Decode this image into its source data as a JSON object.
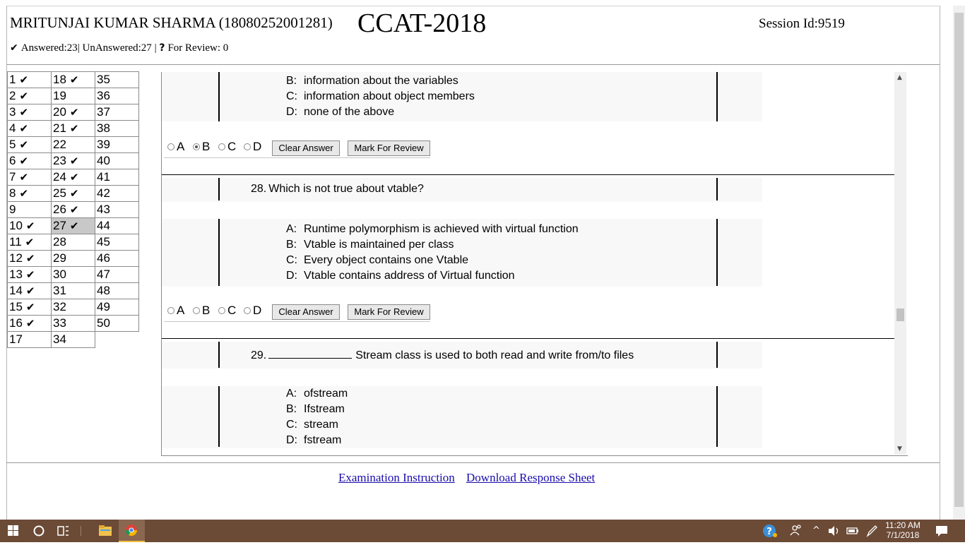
{
  "header": {
    "candidate": "MRITUNJAI KUMAR SHARMA (18080252001281)",
    "exam": "CCAT-2018",
    "session": "Session Id:9519"
  },
  "status": {
    "answered": "Answered:23",
    "sep1": "|",
    "unanswered": "UnAnswered:27",
    "sep2": "|",
    "review_icon": "?",
    "review": "For Review: 0"
  },
  "question_grid": {
    "current": 27,
    "columns": [
      [
        {
          "n": "1",
          "a": true
        },
        {
          "n": "2",
          "a": true
        },
        {
          "n": "3",
          "a": true
        },
        {
          "n": "4",
          "a": true
        },
        {
          "n": "5",
          "a": true
        },
        {
          "n": "6",
          "a": true
        },
        {
          "n": "7",
          "a": true
        },
        {
          "n": "8",
          "a": true
        },
        {
          "n": "9",
          "a": false
        },
        {
          "n": "10",
          "a": true
        },
        {
          "n": "11",
          "a": true
        },
        {
          "n": "12",
          "a": true
        },
        {
          "n": "13",
          "a": true
        },
        {
          "n": "14",
          "a": true
        },
        {
          "n": "15",
          "a": true
        },
        {
          "n": "16",
          "a": true
        },
        {
          "n": "17",
          "a": false
        }
      ],
      [
        {
          "n": "18",
          "a": true
        },
        {
          "n": "19",
          "a": false
        },
        {
          "n": "20",
          "a": true
        },
        {
          "n": "21",
          "a": true
        },
        {
          "n": "22",
          "a": false
        },
        {
          "n": "23",
          "a": true
        },
        {
          "n": "24",
          "a": true
        },
        {
          "n": "25",
          "a": true
        },
        {
          "n": "26",
          "a": true
        },
        {
          "n": "27",
          "a": true
        },
        {
          "n": "28",
          "a": false
        },
        {
          "n": "29",
          "a": false
        },
        {
          "n": "30",
          "a": false
        },
        {
          "n": "31",
          "a": false
        },
        {
          "n": "32",
          "a": false
        },
        {
          "n": "33",
          "a": false
        },
        {
          "n": "34",
          "a": false
        }
      ],
      [
        {
          "n": "35",
          "a": false
        },
        {
          "n": "36",
          "a": false
        },
        {
          "n": "37",
          "a": false
        },
        {
          "n": "38",
          "a": false
        },
        {
          "n": "39",
          "a": false
        },
        {
          "n": "40",
          "a": false
        },
        {
          "n": "41",
          "a": false
        },
        {
          "n": "42",
          "a": false
        },
        {
          "n": "43",
          "a": false
        },
        {
          "n": "44",
          "a": false
        },
        {
          "n": "45",
          "a": false
        },
        {
          "n": "46",
          "a": false
        },
        {
          "n": "47",
          "a": false
        },
        {
          "n": "48",
          "a": false
        },
        {
          "n": "49",
          "a": false
        },
        {
          "n": "50",
          "a": false
        }
      ]
    ]
  },
  "q27": {
    "options": [
      {
        "letter": "B:",
        "text": "information about the variables"
      },
      {
        "letter": "C:",
        "text": "information about object members"
      },
      {
        "letter": "D:",
        "text": "none of the above"
      }
    ],
    "selected": "B"
  },
  "q28": {
    "number": "28.",
    "text": "Which is not true about vtable?",
    "options": [
      {
        "letter": "A:",
        "text": "Runtime polymorphism is achieved with virtual function"
      },
      {
        "letter": "B:",
        "text": "Vtable is maintained per class"
      },
      {
        "letter": "C:",
        "text": "Every object contains one Vtable"
      },
      {
        "letter": "D:",
        "text": "Vtable contains address of Virtual function"
      }
    ],
    "selected": ""
  },
  "q29": {
    "number": "29.",
    "text": "Stream class is used to both read and write from/to files",
    "options": [
      {
        "letter": "A:",
        "text": "ofstream"
      },
      {
        "letter": "B:",
        "text": "Ifstream"
      },
      {
        "letter": "C:",
        "text": "stream"
      },
      {
        "letter": "D:",
        "text": "fstream"
      }
    ]
  },
  "answer_bar": {
    "labels": [
      "A",
      "B",
      "C",
      "D"
    ],
    "clear": "Clear Answer",
    "review": "Mark For Review"
  },
  "links": {
    "instruction": "Examination Instruction",
    "download": "Download Response Sheet"
  },
  "taskbar": {
    "time": "11:20 AM",
    "date": "7/1/2018",
    "notification_icon": "speech-bubble",
    "help_icon": "question-mark"
  },
  "colors": {
    "taskbar": "#6b4a36",
    "current_question": "#c8c8c8",
    "link": "#1a0dab"
  }
}
